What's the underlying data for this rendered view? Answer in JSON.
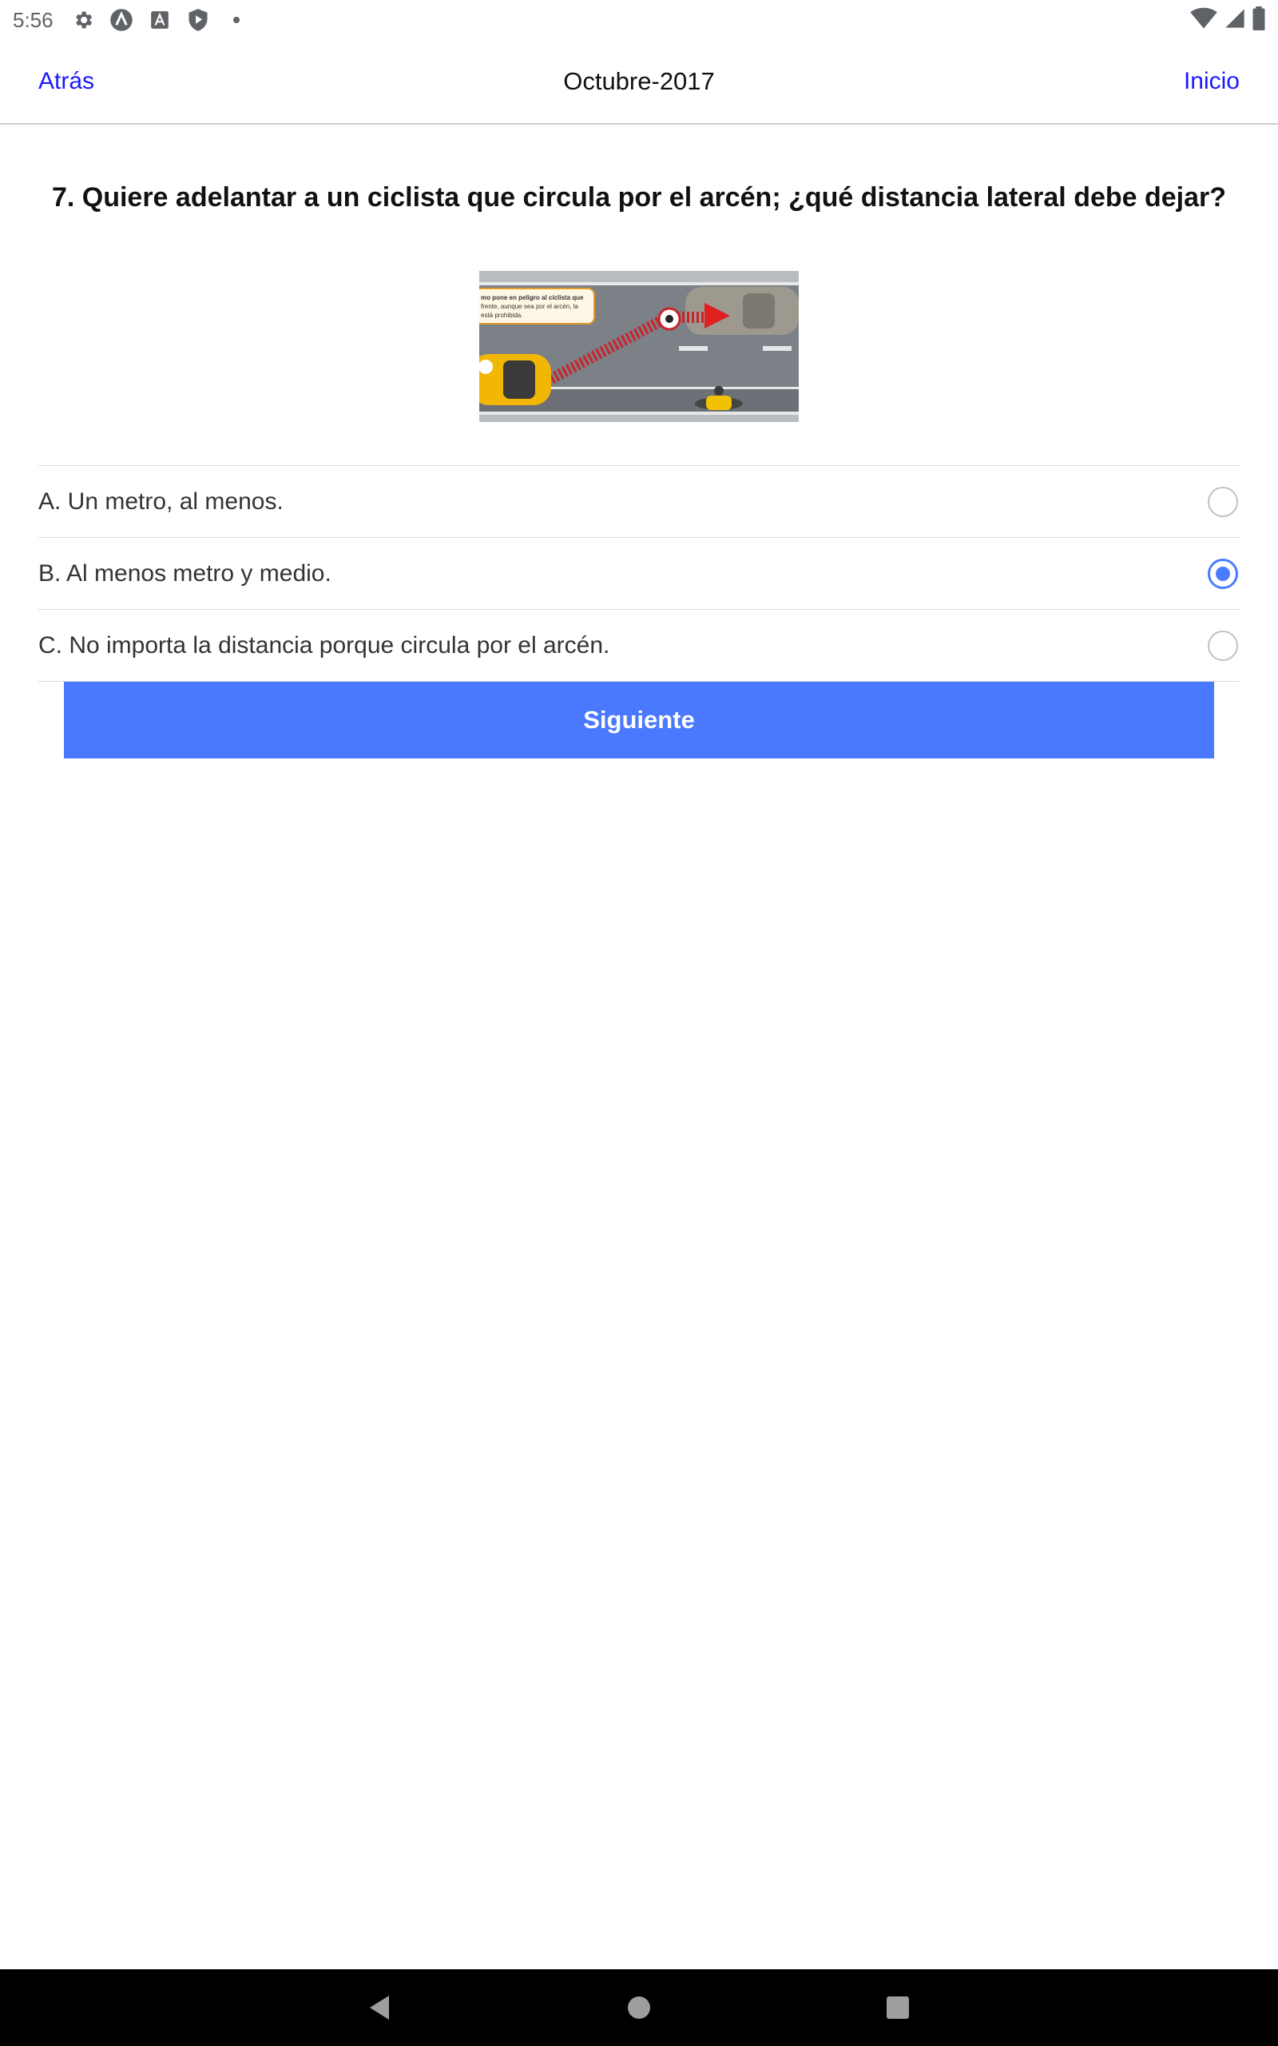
{
  "status_bar": {
    "time": "5:56",
    "left_icons": [
      "gear-icon",
      "app-a-icon",
      "font-icon",
      "shield-play-icon",
      "dot-icon"
    ],
    "right_icons": [
      "wifi-icon",
      "signal-icon",
      "battery-icon"
    ]
  },
  "header": {
    "back_label": "Atrás",
    "title": "Octubre-2017",
    "home_label": "Inicio"
  },
  "question": {
    "text": "7. Quiere adelantar a un ciclista que circula por el arcén; ¿qué distancia lateral debe dejar?",
    "figure_caption": "mo pone en peligro al ciclista que frente, aunque sea por el arcén, la está prohibida."
  },
  "options": [
    {
      "label": "A. Un metro, al menos.",
      "selected": false
    },
    {
      "label": "B. Al menos metro y medio.",
      "selected": true
    },
    {
      "label": "C. No importa la distancia porque circula por el arcén.",
      "selected": false
    }
  ],
  "next_button": "Siguiente",
  "colors": {
    "link": "#1a1aff",
    "accent": "#4a79ff",
    "radio_selected": "#4a7cff"
  },
  "nav_bar": {
    "icons": [
      "back-triangle-icon",
      "home-circle-icon",
      "recents-square-icon"
    ]
  }
}
